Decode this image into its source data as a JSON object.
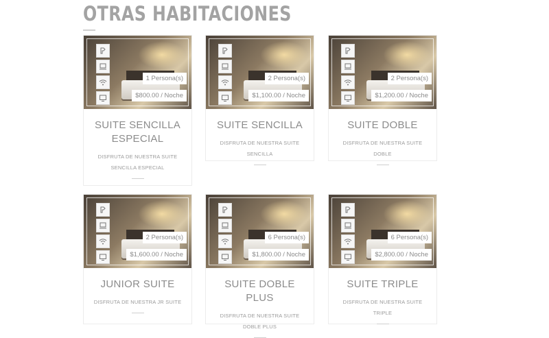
{
  "section": {
    "title": "OTRAS HABITACIONES"
  },
  "amenity_icons": [
    "hairdryer-icon",
    "tv-stand-icon",
    "wifi-icon",
    "monitor-icon"
  ],
  "rooms": [
    {
      "name": "SUITE SENCILLA ESPECIAL",
      "description": "DISFRUTA DE NUESTRA SUITE SENCILLA ESPECIAL",
      "persons": "1 Persona(s)",
      "price": "$800.00 / Noche"
    },
    {
      "name": "SUITE SENCILLA",
      "description": "DISFRUTA DE NUESTRA SUITE SENCILLA",
      "persons": "2 Persona(s)",
      "price": "$1,100.00 / Noche"
    },
    {
      "name": "SUITE DOBLE",
      "description": "DISFRUTA DE NUESTRA SUITE DOBLE",
      "persons": "2 Persona(s)",
      "price": "$1,200.00 / Noche"
    },
    {
      "name": "JUNIOR SUITE",
      "description": "DISFRUTA DE NUESTRA JR SUITE",
      "persons": "2 Persona(s)",
      "price": "$1,600.00 / Noche"
    },
    {
      "name": "SUITE DOBLE PLUS",
      "description": "DISFRUTA DE NUESTRA SUITE DOBLE PLUS",
      "persons": "6 Persona(s)",
      "price": "$1,800.00 / Noche"
    },
    {
      "name": "SUITE TRIPLE",
      "description": "DISFRUTA DE NUESTRA SUITE TRIPLE",
      "persons": "6 Persona(s)",
      "price": "$2,800.00 / Noche"
    }
  ]
}
